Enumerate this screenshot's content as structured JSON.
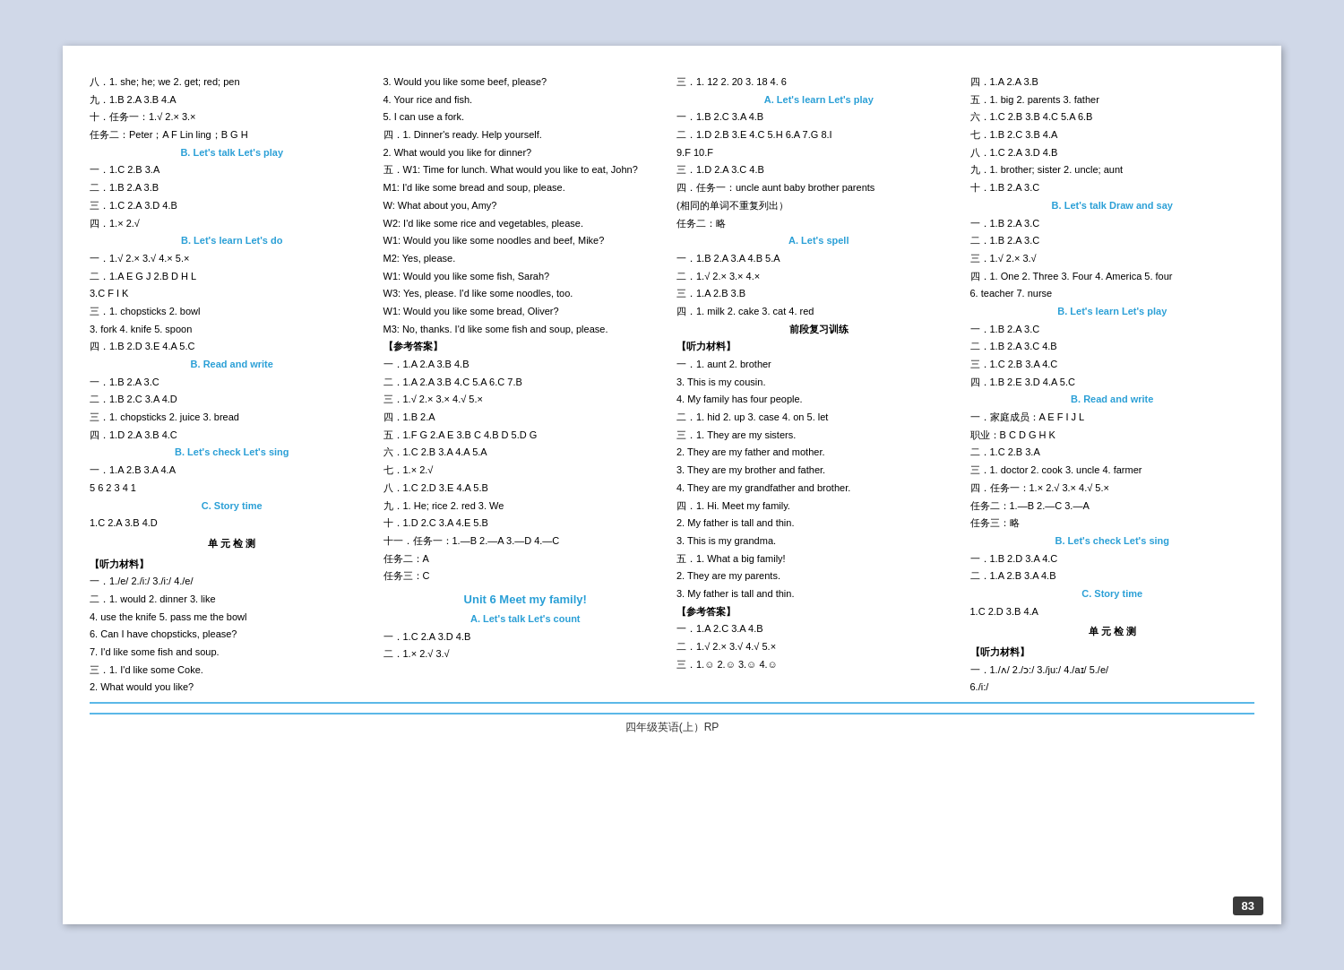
{
  "page": {
    "number": "83",
    "footer": "四年级英语(上）RP"
  },
  "col1": {
    "lines": [
      "八．1. she; he; we  2. get; red; pen",
      "九．1.B  2.A  3.B  4.A",
      "十．任务一：1.√  2.×  3.×",
      "    任务二：Peter；A  F  Lin ling；B  G  H",
      "    B. Let's talk  Let's play",
      "一．1.C  2.B  3.A",
      "二．1.B  2.A  3.B",
      "三．1.C  2.A  3.D  4.B",
      "四．1.×  2.√",
      "    B. Let's learn  Let's do",
      "一．1.√  2.×  3.√  4.×  5.×",
      "二．1.A  E  G  J  2.B  D  H  L",
      "    3.C  F  I  K",
      "三．1. chopsticks  2. bowl",
      "    3. fork  4. knife  5. spoon",
      "四．1.B  2.D  3.E  4.A  5.C",
      "    B. Read and write",
      "一．1.B  2.A  3.C",
      "二．1.B  2.C  3.A  4.D",
      "三．1. chopsticks  2. juice  3. bread",
      "四．1.D  2.A  3.B  4.C",
      "    B. Let's check  Let's sing",
      "一．1.A  2.B  3.A  4.A",
      "    5  6  2  3  4  1",
      "    C. Story time",
      "1.C  2.A  3.B  4.D",
      "    单 元 检 测",
      "【听力材料】",
      "一．1./e/  2./i:/  3./i:/  4./e/",
      "二．1. would  2. dinner  3. like",
      "    4. use the knife  5. pass me the bowl",
      "    6. Can I have chopsticks, please?",
      "    7. I'd like some fish and soup.",
      "三．1. I'd like some Coke.",
      "    2. What would you like?"
    ]
  },
  "col2": {
    "lines": [
      "    3. Would you like some beef, please?",
      "    4. Your rice and fish.",
      "    5. I can use a fork.",
      "四．1. Dinner's ready. Help yourself.",
      "    2. What would you like for dinner?",
      "五．W1: Time for lunch. What would you like to eat, John?",
      "    M1: I'd like some bread and soup, please.",
      "    W: What about you, Amy?",
      "    W2: I'd like some rice and vegetables, please.",
      "    W1: Would you like some noodles and beef, Mike?",
      "    M2: Yes, please.",
      "    W1: Would you like some fish, Sarah?",
      "    W3: Yes, please. I'd like some noodles, too.",
      "    W1: Would you like some bread, Oliver?",
      "    M3: No, thanks. I'd like some fish and soup, please.",
      "【参考答案】",
      "一．1.A  2.A  3.B  4.B",
      "二．1.A  2.A  3.B  4.C  5.A  6.C  7.B",
      "三．1.√  2.×  3.×  4.√  5.×",
      "四．1.B  2.A",
      "五．1.F  G  2.A  E  3.B  C  4.B  D  5.D  G",
      "六．1.C  2.B  3.A  4.A  5.A",
      "七．1.×  2.√",
      "八．1.C  2.D  3.E  4.A  5.B",
      "九．1. He; rice  2. red  3. We",
      "十．1.D  2.C  3.A  4.E  5.B",
      "十一．任务一：1.—B  2.—A  3.—D  4.—C",
      "      任务二：A",
      "      任务三：C",
      "Unit 6  Meet my family!",
      "    A. Let's talk  Let's count",
      "一．1.C  2.A  3.D  4.B",
      "二．1.×  2.√  3.√"
    ]
  },
  "col3": {
    "lines": [
      "三．1. 12  2. 20  3. 18  4. 6",
      "    A. Let's learn  Let's play",
      "一．1.B  2.C  3.A  4.B",
      "二．1.D  2.B  3.E  4.C  5.H  6.A  7.G  8.I",
      "    9.F  10.F",
      "三．1.D  2.A  3.C  4.B",
      "四．任务一：uncle  aunt  baby brother  parents",
      "    (相同的单词不重复列出）",
      "    任务二：略",
      "    A. Let's spell",
      "一．1.B  2.A  3.A  4.B  5.A",
      "二．1.√  2.×  3.×  4.×",
      "三．1.A  2.B  3.B",
      "四．1. milk  2. cake  3. cat  4. red",
      "    前段复习训练",
      "【听力材料】",
      "一．1. aunt  2. brother",
      "    3. This is my cousin.",
      "    4. My family has four people.",
      "二．1. hid  2. up  3. case  4. on  5. let",
      "三．1. They are my sisters.",
      "    2. They are my father and mother.",
      "    3. They are my brother and father.",
      "    4. They are my grandfather and brother.",
      "四．1. Hi. Meet my family.",
      "    2. My father is tall and thin.",
      "    3. This is my grandma.",
      "五．1. What a big family!",
      "    2. They are my parents.",
      "    3. My father is tall and thin.",
      "【参考答案】",
      "一．1.A  2.C  3.A  4.B",
      "二．1.√  2.×  3.√  4.√  5.×",
      "三．1.☺  2.☺  3.☺  4.☺"
    ]
  },
  "col4": {
    "lines": [
      "四．1.A  2.A  3.B",
      "五．1. big  2. parents  3. father",
      "六．1.C  2.B  3.B  4.C  5.A  6.B",
      "七．1.B  2.C  3.B  4.A",
      "八．1.C  2.A  3.D  4.B",
      "九．1. brother; sister  2. uncle; aunt",
      "十．1.B  2.A  3.C",
      "    B. Let's talk  Draw and say",
      "一．1.B  2.A  3.C",
      "二．1.B  2.A  3.C",
      "三．1.√  2.×  3.√",
      "四．1. One  2. Three  3. Four  4. America  5. four",
      "    6. teacher  7. nurse",
      "    B. Let's learn  Let's play",
      "一．1.B  2.A  3.C",
      "二．1.B  2.A  3.C  4.B",
      "三．1.C  2.B  3.A  4.C",
      "四．1.B  2.E  3.D  4.A  5.C",
      "    B. Read and write",
      "一．家庭成员：A  E  F  I  J  L",
      "    职业：B  C  D  G  H  K",
      "二．1.C  2.B  3.A",
      "三．1. doctor  2. cook  3. uncle  4. farmer",
      "四．任务一：1.×  2.√  3.×  4.√  5.×",
      "    任务二：1.—B  2.—C  3.—A",
      "    任务三：略",
      "    B. Let's check  Let's sing",
      "一．1.B  2.D  3.A  4.C",
      "二．1.A  2.B  3.A  4.B",
      "    C. Story time",
      "1.C  2.D  3.B  4.A",
      "    单 元 检 测",
      "【听力材料】",
      "一．1./ʌ/  2./ɔ:/  3./ju:/  4./aɪ/  5./e/",
      "    6./i:/"
    ]
  }
}
